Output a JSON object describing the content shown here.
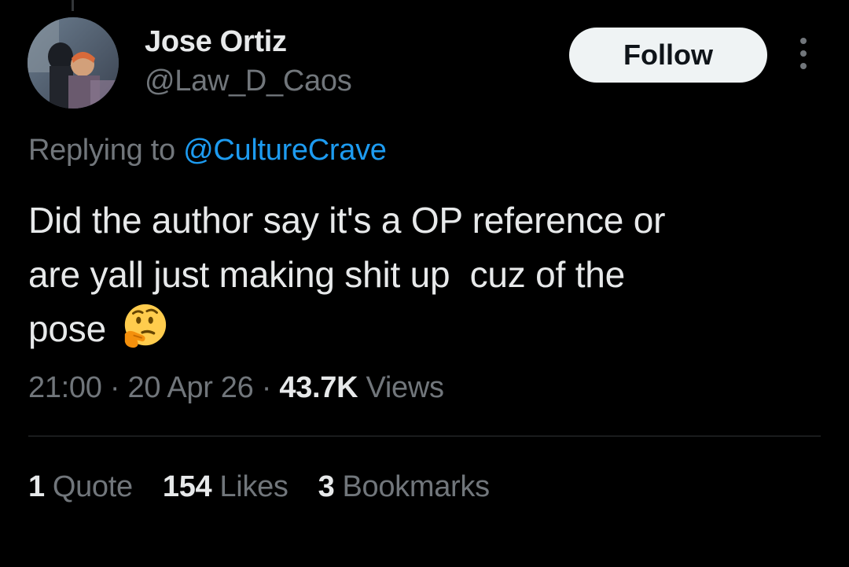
{
  "author": {
    "display_name": "Jose Ortiz",
    "handle": "@Law_D_Caos"
  },
  "follow_label": "Follow",
  "reply": {
    "prefix": "Replying to",
    "mention": "@CultureCrave"
  },
  "tweet": {
    "text": "Did the author say it's a OP reference or\nare yall just making shit up  cuz of the\npose",
    "emoji": "thinking-face"
  },
  "meta": {
    "time": "21:00",
    "separator": "·",
    "date": "20 Apr 26",
    "views_count": "43.7K",
    "views_label": "Views"
  },
  "stats": [
    {
      "count": "1",
      "label": "Quote"
    },
    {
      "count": "154",
      "label": "Likes"
    },
    {
      "count": "3",
      "label": "Bookmarks"
    }
  ],
  "colors": {
    "background": "#000000",
    "primary_text": "#e7e9ea",
    "secondary_text": "#71767b",
    "mention": "#1d9bf0",
    "follow_bg": "#eff3f4"
  },
  "icons": [
    "avatar",
    "more-icon",
    "thinking-face-emoji"
  ]
}
